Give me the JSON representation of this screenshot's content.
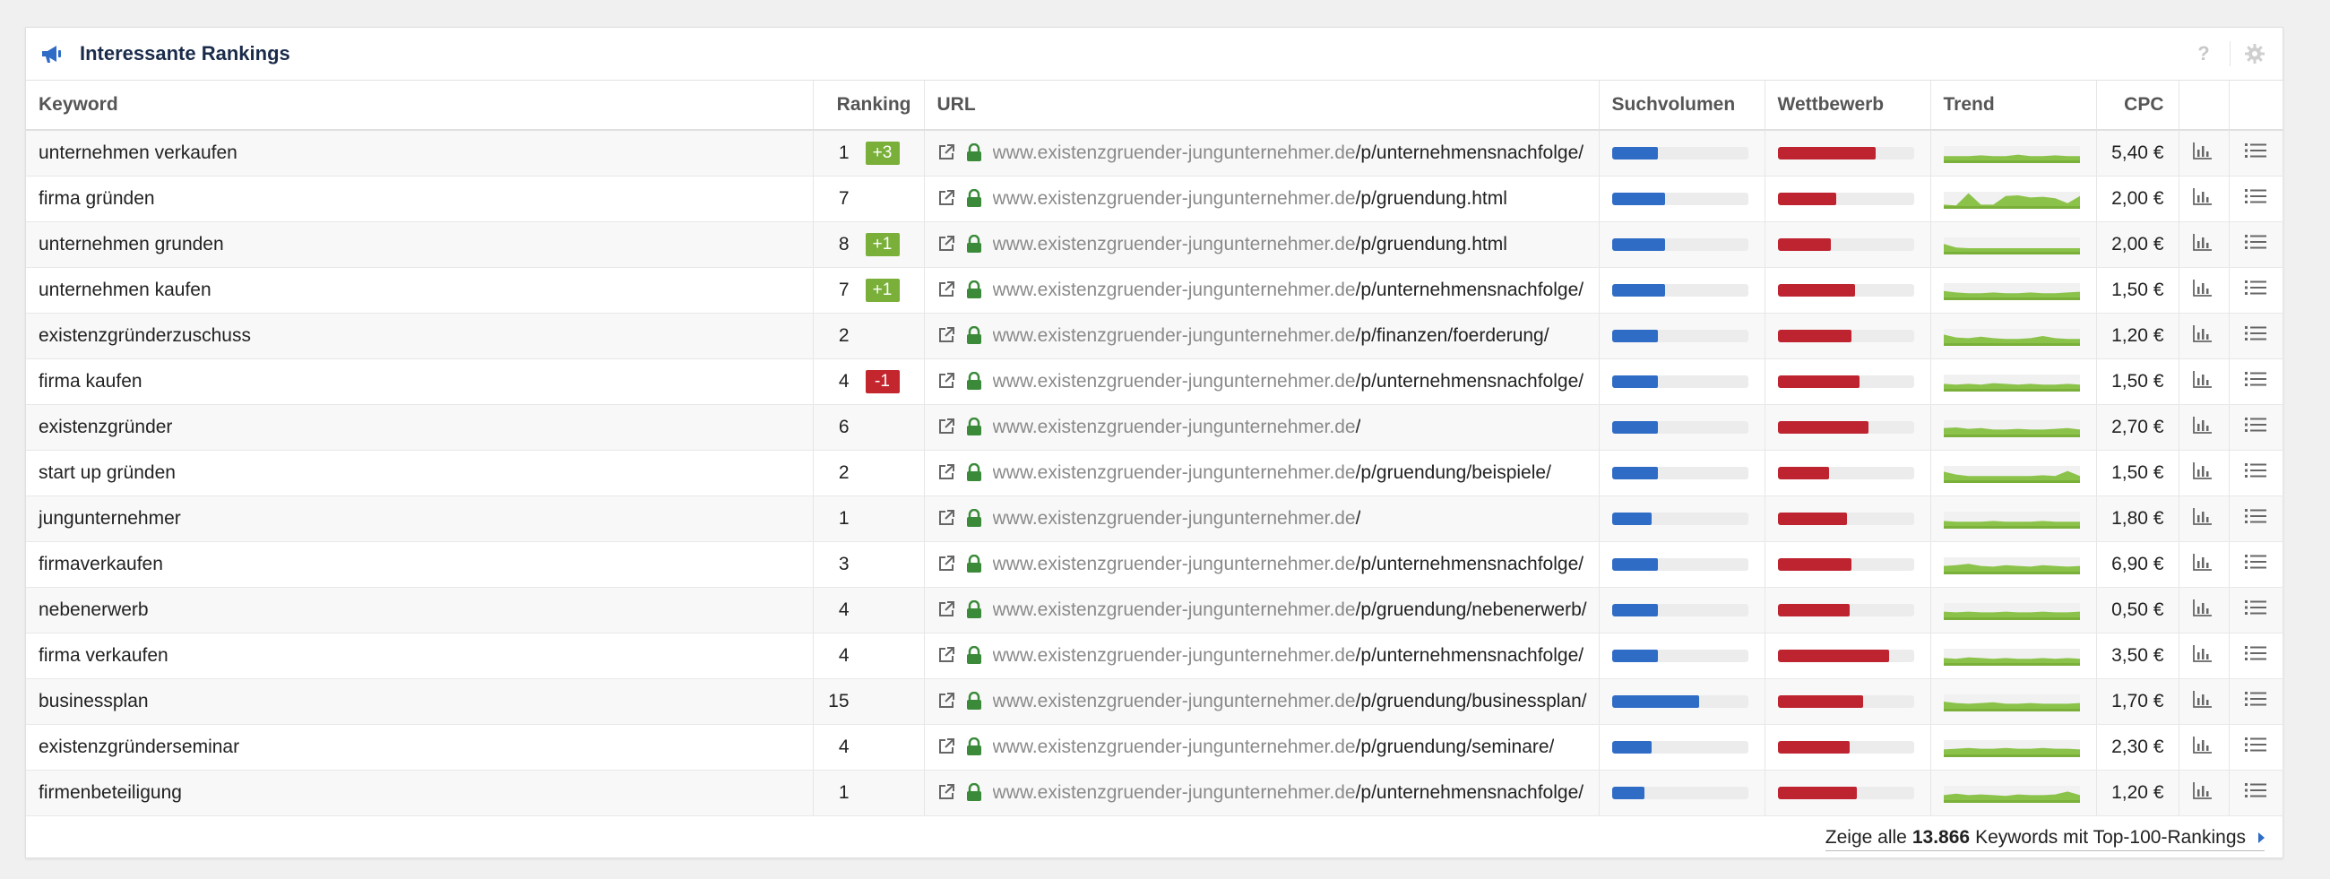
{
  "widget": {
    "title": "Interessante Rankings",
    "help_label": "?"
  },
  "columns": {
    "keyword": "Keyword",
    "ranking": "Ranking",
    "url": "URL",
    "suchvolumen": "Suchvolumen",
    "wettbewerb": "Wettbewerb",
    "trend": "Trend",
    "cpc": "CPC"
  },
  "colors": {
    "accent_blue": "#2f6cc6",
    "competition_red": "#be2330",
    "trend_green": "#8bc34a",
    "badge_up": "#7ab03a",
    "badge_down": "#c4262e"
  },
  "rows": [
    {
      "keyword": "unternehmen verkaufen",
      "rank": "1",
      "change": "+3",
      "dir": "up",
      "domain": "www.existenzgruender-jungunternehmer.de",
      "path": "/p/unternehmensnachfolge/",
      "volume": 0.34,
      "competition": 0.72,
      "trend": [
        0.3,
        0.3,
        0.3,
        0.35,
        0.3,
        0.3,
        0.4,
        0.3,
        0.3,
        0.35,
        0.3,
        0.3
      ],
      "cpc": "5,40 €"
    },
    {
      "keyword": "firma gründen",
      "rank": "7",
      "change": "",
      "dir": "",
      "domain": "www.existenzgruender-jungunternehmer.de",
      "path": "/p/gruendung.html",
      "volume": 0.39,
      "competition": 0.43,
      "trend": [
        0.1,
        0.05,
        0.9,
        0.1,
        0.1,
        0.7,
        0.75,
        0.6,
        0.65,
        0.55,
        0.2,
        0.7
      ],
      "cpc": "2,00 €"
    },
    {
      "keyword": "unternehmen grunden",
      "rank": "8",
      "change": "+1",
      "dir": "up",
      "domain": "www.existenzgruender-jungunternehmer.de",
      "path": "/p/gruendung.html",
      "volume": 0.39,
      "competition": 0.39,
      "trend": [
        0.55,
        0.3,
        0.25,
        0.25,
        0.25,
        0.25,
        0.25,
        0.25,
        0.25,
        0.25,
        0.25,
        0.25
      ],
      "cpc": "2,00 €"
    },
    {
      "keyword": "unternehmen kaufen",
      "rank": "7",
      "change": "+1",
      "dir": "up",
      "domain": "www.existenzgruender-jungunternehmer.de",
      "path": "/p/unternehmensnachfolge/",
      "volume": 0.39,
      "competition": 0.57,
      "trend": [
        0.45,
        0.35,
        0.3,
        0.3,
        0.35,
        0.3,
        0.3,
        0.35,
        0.3,
        0.3,
        0.35,
        0.4
      ],
      "cpc": "1,50 €"
    },
    {
      "keyword": "existenzgründerzuschuss",
      "rank": "2",
      "change": "",
      "dir": "",
      "domain": "www.existenzgruender-jungunternehmer.de",
      "path": "/p/finanzen/foerderung/",
      "volume": 0.34,
      "competition": 0.54,
      "trend": [
        0.6,
        0.4,
        0.35,
        0.45,
        0.35,
        0.3,
        0.3,
        0.35,
        0.5,
        0.35,
        0.3,
        0.3
      ],
      "cpc": "1,20 €"
    },
    {
      "keyword": "firma kaufen",
      "rank": "4",
      "change": "-1",
      "dir": "down",
      "domain": "www.existenzgruender-jungunternehmer.de",
      "path": "/p/unternehmensnachfolge/",
      "volume": 0.34,
      "competition": 0.6,
      "trend": [
        0.35,
        0.3,
        0.35,
        0.3,
        0.4,
        0.35,
        0.3,
        0.35,
        0.3,
        0.3,
        0.35,
        0.3
      ],
      "cpc": "1,50 €"
    },
    {
      "keyword": "existenzgründer",
      "rank": "6",
      "change": "",
      "dir": "",
      "domain": "www.existenzgruender-jungunternehmer.de",
      "path": "/",
      "volume": 0.34,
      "competition": 0.67,
      "trend": [
        0.45,
        0.5,
        0.4,
        0.45,
        0.35,
        0.35,
        0.4,
        0.35,
        0.35,
        0.4,
        0.45,
        0.35
      ],
      "cpc": "2,70 €"
    },
    {
      "keyword": "start up gründen",
      "rank": "2",
      "change": "",
      "dir": "",
      "domain": "www.existenzgruender-jungunternehmer.de",
      "path": "/p/gruendung/beispiele/",
      "volume": 0.34,
      "competition": 0.38,
      "trend": [
        0.6,
        0.4,
        0.3,
        0.3,
        0.3,
        0.3,
        0.3,
        0.3,
        0.35,
        0.3,
        0.65,
        0.3
      ],
      "cpc": "1,50 €"
    },
    {
      "keyword": "jungunternehmer",
      "rank": "1",
      "change": "",
      "dir": "",
      "domain": "www.existenzgruender-jungunternehmer.de",
      "path": "/",
      "volume": 0.29,
      "competition": 0.51,
      "trend": [
        0.35,
        0.3,
        0.3,
        0.3,
        0.35,
        0.3,
        0.3,
        0.3,
        0.35,
        0.3,
        0.3,
        0.3
      ],
      "cpc": "1,80 €"
    },
    {
      "keyword": "firmaverkaufen",
      "rank": "3",
      "change": "",
      "dir": "",
      "domain": "www.existenzgruender-jungunternehmer.de",
      "path": "/p/unternehmensnachfolge/",
      "volume": 0.34,
      "competition": 0.54,
      "trend": [
        0.4,
        0.45,
        0.55,
        0.4,
        0.35,
        0.45,
        0.4,
        0.35,
        0.45,
        0.4,
        0.35,
        0.4
      ],
      "cpc": "6,90 €"
    },
    {
      "keyword": "nebenerwerb",
      "rank": "4",
      "change": "",
      "dir": "",
      "domain": "www.existenzgruender-jungunternehmer.de",
      "path": "/p/gruendung/nebenerwerb/",
      "volume": 0.34,
      "competition": 0.53,
      "trend": [
        0.4,
        0.35,
        0.4,
        0.35,
        0.35,
        0.4,
        0.35,
        0.35,
        0.4,
        0.35,
        0.35,
        0.4
      ],
      "cpc": "0,50 €"
    },
    {
      "keyword": "firma verkaufen",
      "rank": "4",
      "change": "",
      "dir": "",
      "domain": "www.existenzgruender-jungunternehmer.de",
      "path": "/p/unternehmensnachfolge/",
      "volume": 0.34,
      "competition": 0.82,
      "trend": [
        0.35,
        0.3,
        0.4,
        0.35,
        0.3,
        0.35,
        0.3,
        0.3,
        0.35,
        0.3,
        0.35,
        0.3
      ],
      "cpc": "3,50 €"
    },
    {
      "keyword": "businessplan",
      "rank": "15",
      "change": "",
      "dir": "",
      "domain": "www.existenzgruender-jungunternehmer.de",
      "path": "/p/gruendung/businessplan/",
      "volume": 0.64,
      "competition": 0.63,
      "trend": [
        0.5,
        0.4,
        0.35,
        0.4,
        0.45,
        0.35,
        0.35,
        0.4,
        0.35,
        0.35,
        0.35,
        0.4
      ],
      "cpc": "1,70 €"
    },
    {
      "keyword": "existenzgründerseminar",
      "rank": "4",
      "change": "",
      "dir": "",
      "domain": "www.existenzgruender-jungunternehmer.de",
      "path": "/p/gruendung/seminare/",
      "volume": 0.29,
      "competition": 0.53,
      "trend": [
        0.35,
        0.4,
        0.45,
        0.4,
        0.4,
        0.45,
        0.4,
        0.4,
        0.45,
        0.4,
        0.4,
        0.35
      ],
      "cpc": "2,30 €"
    },
    {
      "keyword": "firmenbeteiligung",
      "rank": "1",
      "change": "",
      "dir": "",
      "domain": "www.existenzgruender-jungunternehmer.de",
      "path": "/p/unternehmensnachfolge/",
      "volume": 0.24,
      "competition": 0.58,
      "trend": [
        0.35,
        0.45,
        0.35,
        0.4,
        0.35,
        0.3,
        0.4,
        0.35,
        0.35,
        0.4,
        0.6,
        0.35
      ],
      "cpc": "1,20 €"
    }
  ],
  "footer": {
    "prefix": "Zeige alle",
    "count": "13.866",
    "suffix": "Keywords mit Top-100-Rankings"
  }
}
